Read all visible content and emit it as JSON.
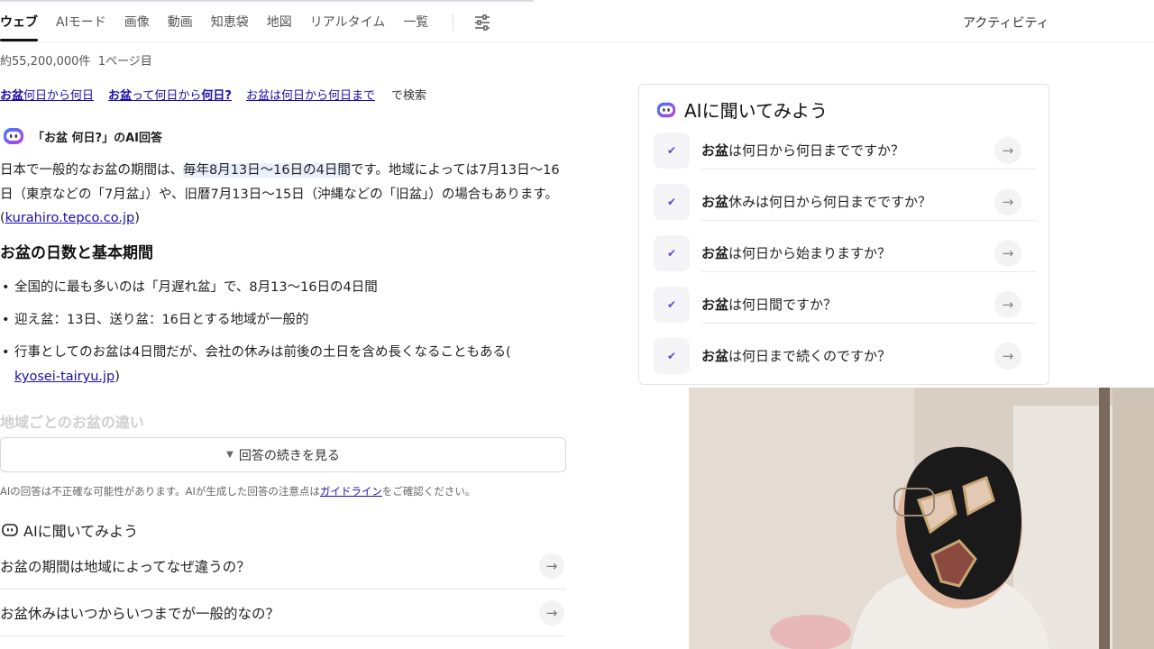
{
  "nav": {
    "tabs": [
      "ウェブ",
      "AIモード",
      "画像",
      "動画",
      "知恵袋",
      "地図",
      "リアルタイム",
      "一覧"
    ],
    "activity": "アクティビティ"
  },
  "results": {
    "count": "約55,200,000件",
    "page": "1ページ目",
    "related_suffix": "で検索"
  },
  "ai_answer": {
    "heading": "「お盆 何日?」のAI回答",
    "para_before": "日本で一般的なお盆の期間は、",
    "para_highlight": "毎年8月13日〜16日の4日間",
    "para_after": "です。地域によっては7月13日〜16日（東京などの「7月盆」）や、旧暦7月13日〜15日（沖縄などの「旧盆」）の場合もあります。(",
    "para_source": "kurahiro.tepco.co.jp",
    "section_title": "お盆の日数と基本期間",
    "bullet1": "全国的に最も多いのは「月遅れ盆」で、8月13〜16日の4日間",
    "bullet2": "迎え盆：13日、送り盆：16日とする地域が一般的",
    "bullet3": "行事としてのお盆は4日間だが、会社の休みは前後の土日を含め長くなることもある(",
    "bullet3_source": "kyosei-tairyu.jp",
    "faded_title": "地域ごとのお盆の違い",
    "more_label": "回答の続きを見る",
    "disclaimer_before": "AIの回答は不正確な可能性があります。AIが生成した回答の注意点は",
    "disclaimer_link": "ガイドライン",
    "disclaimer_after": "をご確認ください。"
  },
  "ask": {
    "title": "AIに聞いてみよう",
    "questions": [
      "お盆の期間は地域によってなぜ違うの？",
      "お盆休みはいつからいつまでが一般的なの？"
    ]
  },
  "panel": {
    "title": "AIに聞いてみよう",
    "keyword": "お盆",
    "items": [
      "は何日から何日までですか？",
      "休みは何日から何日までですか？",
      "は何日から始まりますか？",
      "は何日間ですか？",
      "は何日まで続くのですか？"
    ]
  },
  "colors": {
    "link": "#1a0dab",
    "accent": "#6b3fd1"
  },
  "icons": [
    "filter-icon",
    "ai-bot-icon",
    "chevron-down-icon",
    "arrow-right-icon"
  ]
}
